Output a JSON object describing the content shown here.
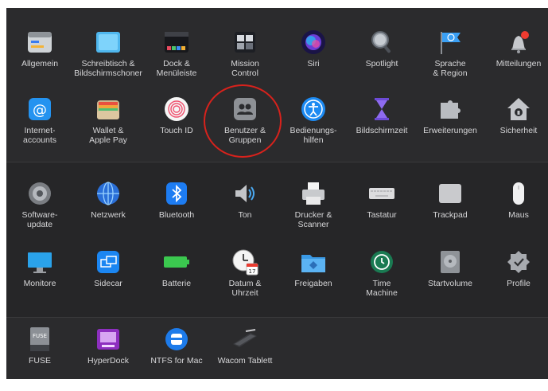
{
  "section_personal": {
    "row1": [
      {
        "label": "Allgemein",
        "icon": "general-icon"
      },
      {
        "label": "Schreibtisch &\nBildschirmschoner",
        "icon": "desktop-screensaver-icon"
      },
      {
        "label": "Dock &\nMenüleiste",
        "icon": "dock-icon"
      },
      {
        "label": "Mission\nControl",
        "icon": "mission-control-icon"
      },
      {
        "label": "Siri",
        "icon": "siri-icon"
      },
      {
        "label": "Spotlight",
        "icon": "spotlight-icon"
      },
      {
        "label": "Sprache\n& Region",
        "icon": "language-region-icon"
      },
      {
        "label": "Mitteilungen",
        "icon": "notifications-icon"
      }
    ],
    "row2": [
      {
        "label": "Internet-\naccounts",
        "icon": "internet-accounts-icon"
      },
      {
        "label": "Wallet &\nApple Pay",
        "icon": "wallet-icon"
      },
      {
        "label": "Touch ID",
        "icon": "touch-id-icon"
      },
      {
        "label": "Benutzer &\nGruppen",
        "icon": "users-groups-icon"
      },
      {
        "label": "Bedienungs-\nhilfen",
        "icon": "accessibility-icon"
      },
      {
        "label": "Bildschirmzeit",
        "icon": "screen-time-icon"
      },
      {
        "label": "Erweiterungen",
        "icon": "extensions-icon"
      },
      {
        "label": "Sicherheit",
        "icon": "security-icon"
      }
    ]
  },
  "section_hardware": {
    "row1": [
      {
        "label": "Software-\nupdate",
        "icon": "software-update-icon"
      },
      {
        "label": "Netzwerk",
        "icon": "network-icon"
      },
      {
        "label": "Bluetooth",
        "icon": "bluetooth-icon"
      },
      {
        "label": "Ton",
        "icon": "sound-icon"
      },
      {
        "label": "Drucker &\nScanner",
        "icon": "printer-icon"
      },
      {
        "label": "Tastatur",
        "icon": "keyboard-icon"
      },
      {
        "label": "Trackpad",
        "icon": "trackpad-icon"
      },
      {
        "label": "Maus",
        "icon": "mouse-icon"
      }
    ],
    "row2": [
      {
        "label": "Monitore",
        "icon": "displays-icon"
      },
      {
        "label": "Sidecar",
        "icon": "sidecar-icon"
      },
      {
        "label": "Batterie",
        "icon": "battery-icon"
      },
      {
        "label": "Datum &\nUhrzeit",
        "icon": "date-time-icon"
      },
      {
        "label": "Freigaben",
        "icon": "sharing-icon"
      },
      {
        "label": "Time\nMachine",
        "icon": "time-machine-icon"
      },
      {
        "label": "Startvolume",
        "icon": "startup-disk-icon"
      },
      {
        "label": "Profile",
        "icon": "profiles-icon"
      }
    ]
  },
  "section_other": {
    "row1": [
      {
        "label": "FUSE",
        "icon": "fuse-icon",
        "badge": "FUSE"
      },
      {
        "label": "HyperDock",
        "icon": "hyperdock-icon"
      },
      {
        "label": "NTFS for Mac",
        "icon": "ntfs-icon"
      },
      {
        "label": "Wacom Tablett",
        "icon": "wacom-tablet-icon"
      }
    ]
  },
  "highlight_color": "#d8221c",
  "date_icon_day": "17"
}
